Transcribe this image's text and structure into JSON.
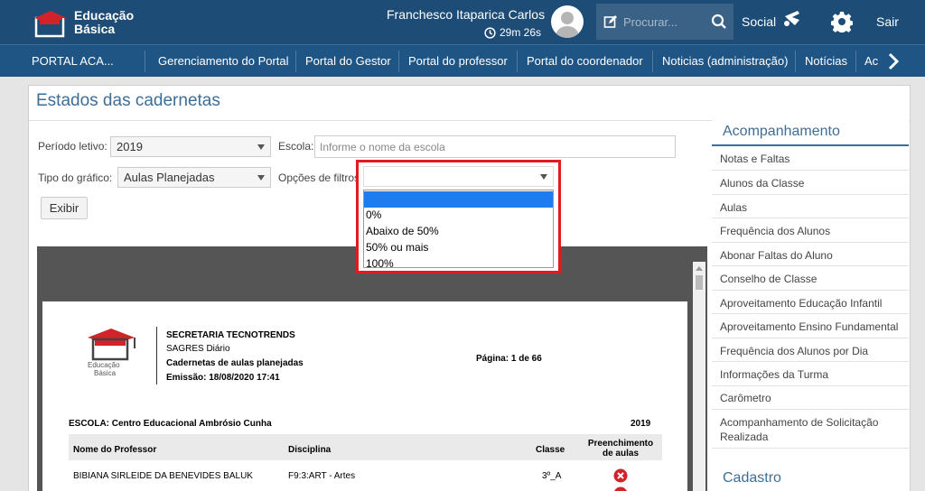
{
  "brand": {
    "line1": "Educação",
    "line2": "Básica"
  },
  "header": {
    "user_name": "Franchesco Itaparica Carlos",
    "session_timer": "29m 26s",
    "search_placeholder": "Procurar...",
    "social_label": "Social",
    "logout_label": "Sair"
  },
  "nav": {
    "items": [
      "PORTAL ACA...",
      "Gerenciamento do Portal",
      "Portal do Gestor",
      "Portal do professor",
      "Portal do coordenador",
      "Noticias (administração)",
      "Notícias",
      "Ac"
    ]
  },
  "page": {
    "title": "Estados das cadernetas",
    "form": {
      "period_label": "Período letivo:",
      "period_value": "2019",
      "school_label": "Escola:",
      "school_placeholder": "Informe o nome da escola",
      "chart_type_label": "Tipo do gráfico:",
      "chart_type_value": "Aulas Planejadas",
      "filter_label": "Opções de filtros:",
      "filter_value": "",
      "filter_options": [
        "",
        "0%",
        "Abaixo de 50%",
        "50% ou mais",
        "100%"
      ],
      "submit_label": "Exibir"
    }
  },
  "report": {
    "org": "SECRETARIA TECNOTRENDS",
    "system": "SAGRES Diário",
    "subtitle": "Cadernetas de aulas planejadas",
    "emission": "Emissão: 18/08/2020 17:41",
    "page": "Página: 1 de 66",
    "logo_line1": "Educação",
    "logo_line2": "Básica",
    "school": "ESCOLA:  Centro Educacional Ambrósio Cunha",
    "year": "2019",
    "columns": [
      "Nome do Professor",
      "Disciplina",
      "Classe",
      "Preenchimento de aulas"
    ],
    "rows": [
      {
        "teacher": "BIBIANA SIRLEIDE DA BENEVIDES BALUK",
        "discipline": "F9:3:ART - Artes",
        "class": "3º_A"
      }
    ]
  },
  "sidebar": {
    "section_title": "Acompanhamento",
    "items": [
      "Notas e Faltas",
      "Alunos da Classe",
      "Aulas",
      "Frequência dos Alunos",
      "Abonar Faltas do Aluno",
      "Conselho de Classe",
      "Aproveitamento Educação Infantil",
      "Aproveitamento Ensino Fundamental",
      "Frequência dos Alunos por Dia",
      "Informações da Turma",
      "Carômetro",
      "Acompanhamento de Solicitação Realizada"
    ],
    "section2_title": "Cadastro"
  },
  "colors": {
    "header_bg": "#1d4c76",
    "nav_bg": "#1f5585",
    "accent": "#3e6e96",
    "highlight_border": "#e01b22",
    "selected_option": "#1e7cf1",
    "status_error": "#d2232a"
  }
}
